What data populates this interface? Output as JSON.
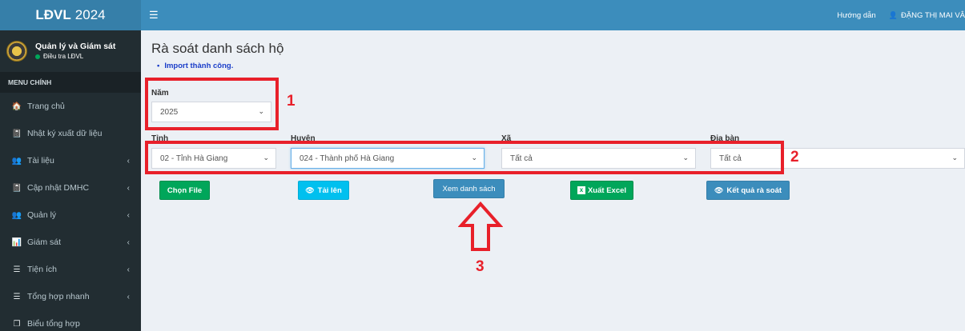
{
  "app": {
    "logo_bold": "LĐVL",
    "logo_year": "2024"
  },
  "user_panel": {
    "name": "Quản lý và Giám sát",
    "status": "Điều tra LĐVL"
  },
  "sidebar": {
    "header": "MENU CHÍNH",
    "items": [
      {
        "label": "Trang chủ",
        "icon": "home-icon",
        "glyph": "🏠",
        "caret": ""
      },
      {
        "label": "Nhật ký xuất dữ liệu",
        "icon": "book-icon",
        "glyph": "📓",
        "caret": ""
      },
      {
        "label": "Tài liệu",
        "icon": "users-icon",
        "glyph": "👥",
        "caret": "‹"
      },
      {
        "label": "Cập nhật DMHC",
        "icon": "book-icon",
        "glyph": "📓",
        "caret": "‹"
      },
      {
        "label": "Quản lý",
        "icon": "users-icon",
        "glyph": "👥",
        "caret": "‹"
      },
      {
        "label": "Giám sát",
        "icon": "chart-icon",
        "glyph": "📊",
        "caret": "‹"
      },
      {
        "label": "Tiện ích",
        "icon": "list-icon",
        "glyph": "☰",
        "caret": "‹"
      },
      {
        "label": "Tổng hợp nhanh",
        "icon": "list-icon",
        "glyph": "☰",
        "caret": "‹"
      },
      {
        "label": "Biểu tổng hợp",
        "icon": "copy-icon",
        "glyph": "❐",
        "caret": ""
      }
    ]
  },
  "topbar": {
    "help": "Hướng dẫn",
    "user": "ĐẶNG THỊ MAI VÂ"
  },
  "page": {
    "title": "Rà soát danh sách hộ",
    "message": "Import thành công."
  },
  "filters": {
    "year_label": "Năm",
    "year_value": "2025",
    "province_label": "Tỉnh",
    "province_value": "02 - Tỉnh Hà Giang",
    "district_label": "Huyện",
    "district_value": "024 - Thành phố Hà Giang",
    "commune_label": "Xã",
    "commune_value": "Tất cả",
    "area_label": "Địa bàn",
    "area_value": "Tất cả"
  },
  "buttons": {
    "choose_file": "Chọn File",
    "upload": "Tải lên",
    "view_list": "Xem danh sách",
    "export_excel": "Xuất Excel",
    "review_result": "Kết quả rà soát"
  },
  "annotations": {
    "one": "1",
    "two": "2",
    "three": "3"
  },
  "colors": {
    "sidebar": "#222d32",
    "topbar": "#3c8dbc",
    "annotation": "#e8202a"
  }
}
